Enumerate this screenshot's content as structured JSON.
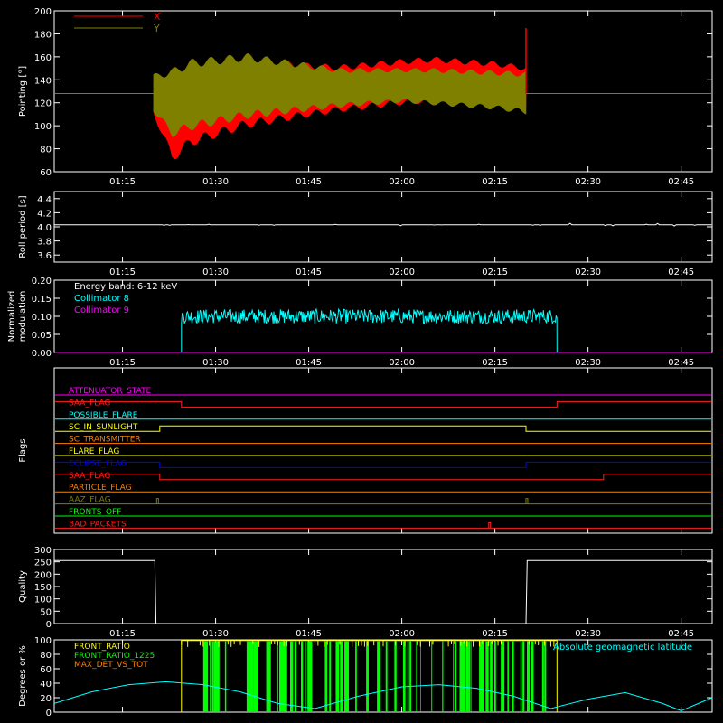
{
  "chart_data": [
    {
      "type": "line",
      "ylabel": "Pointing [°]",
      "ylim": [
        60,
        200
      ],
      "yticks": [
        "60",
        "80",
        "100",
        "120",
        "140",
        "160",
        "180",
        "200"
      ],
      "xticks": [
        "01:15",
        "01:30",
        "01:45",
        "02:00",
        "02:15",
        "02:30",
        "02:45"
      ],
      "xlim_minutes": [
        64,
        170
      ],
      "legend_placement": "top-left",
      "series": [
        {
          "name": "X",
          "color": "#ff0000",
          "baseline": 128,
          "active_start_min": 80,
          "active_end_min": 140,
          "envelope_start_min": [
            80,
            83,
            86,
            95,
            110,
            120,
            125,
            135,
            140
          ],
          "upper": [
            140,
            148,
            152,
            158,
            153,
            158,
            160,
            156,
            152
          ],
          "lower": [
            110,
            68,
            82,
            98,
            112,
            118,
            120,
            118,
            116
          ]
        },
        {
          "name": "Y",
          "color": "#808000",
          "baseline": 128,
          "active_start_min": 80,
          "active_end_min": 140,
          "envelope_start_min": [
            80,
            83,
            86,
            95,
            110,
            120,
            125,
            135,
            140
          ],
          "upper": [
            145,
            150,
            158,
            163,
            150,
            150,
            150,
            148,
            147
          ],
          "lower": [
            112,
            90,
            96,
            106,
            116,
            120,
            118,
            114,
            110
          ]
        }
      ]
    },
    {
      "type": "line",
      "ylabel": "Roll period [s]",
      "ylim": [
        3.5,
        4.5
      ],
      "yticks": [
        "3.6",
        "3.8",
        "4.0",
        "4.2",
        "4.4"
      ],
      "xticks": [
        "01:15",
        "01:30",
        "01:45",
        "02:00",
        "02:15",
        "02:30",
        "02:45"
      ],
      "series": [
        {
          "name": "",
          "color": "#ffffff",
          "value": 4.03
        }
      ]
    },
    {
      "type": "line",
      "ylabel": "Normalized modulation",
      "ylim": [
        0,
        0.2
      ],
      "yticks": [
        "0.00",
        "0.05",
        "0.10",
        "0.15",
        "0.20"
      ],
      "xticks": [
        "01:15",
        "01:30",
        "01:45",
        "02:00",
        "02:15",
        "02:30",
        "02:45"
      ],
      "annotation": "Energy band: 6-12 keV",
      "series": [
        {
          "name": "Collimator 8",
          "color": "#00ffff",
          "start_min": 84.5,
          "end_min": 145,
          "mean": 0.1,
          "spread": 0.02
        },
        {
          "name": "Collimator 9",
          "color": "#ff00ff",
          "value": 0.0
        }
      ]
    },
    {
      "type": "line",
      "ylabel": "Flags",
      "series": [
        {
          "name": "ATTENUATOR_STATE",
          "color": "#ff00ff",
          "changes": []
        },
        {
          "name": "SAA_FLAG",
          "color": "#ff2020",
          "changes": [
            [
              84.5,
              1,
              0
            ],
            [
              145,
              0,
              1
            ]
          ]
        },
        {
          "name": "POSSIBLE_FLARE",
          "color": "#00ffff",
          "changes": []
        },
        {
          "name": "SC_IN_SUNLIGHT",
          "color": "#ffff00",
          "changes": [
            [
              81,
              0,
              1
            ],
            [
              140,
              1,
              0
            ]
          ]
        },
        {
          "name": "SC_TRANSMITTER",
          "color": "#ff8000",
          "changes": []
        },
        {
          "name": "FLARE_FLAG",
          "color": "#ffff00",
          "changes": []
        },
        {
          "name": "ECLIPSE_FLAG",
          "color": "#0000ff",
          "changes": [
            [
              81,
              1,
              0
            ],
            [
              140,
              0,
              1
            ]
          ]
        },
        {
          "name": "SAA_FLAG",
          "color": "#ff2020",
          "changes": [
            [
              81,
              1,
              0
            ],
            [
              152.5,
              0,
              1
            ]
          ]
        },
        {
          "name": "PARTICLE_FLAG",
          "color": "#ff8000",
          "changes": []
        },
        {
          "name": "AAZ_FLAG",
          "color": "#808000",
          "spikes": [
            80.5,
            140
          ]
        },
        {
          "name": "FRONTS_OFF",
          "color": "#00ff00",
          "changes": []
        },
        {
          "name": "BAD_PACKETS",
          "color": "#ff2020",
          "spikes": [
            134
          ]
        }
      ]
    },
    {
      "type": "line",
      "ylabel": "Quality",
      "ylim": [
        0,
        300
      ],
      "yticks": [
        "0",
        "50",
        "100",
        "150",
        "200",
        "250",
        "300"
      ],
      "xticks": [
        "01:15",
        "01:30",
        "01:45",
        "02:00",
        "02:15",
        "02:30",
        "02:45"
      ],
      "series": [
        {
          "name": "",
          "color": "#ffffff",
          "points": [
            [
              64,
              255
            ],
            [
              80.2,
              255
            ],
            [
              80.4,
              0
            ],
            [
              140,
              0
            ],
            [
              140.2,
              255
            ],
            [
              170,
              255
            ]
          ]
        }
      ]
    },
    {
      "type": "line",
      "ylabel": "Degrees or %",
      "ylim": [
        0,
        100
      ],
      "yticks": [
        "0",
        "20",
        "40",
        "60",
        "80",
        "100"
      ],
      "annotation": "Absolute geomagnetic latitude",
      "series": [
        {
          "name": "FRONT_RATIO",
          "color": "#ffff00",
          "start_min": 84.5,
          "end_min": 145
        },
        {
          "name": "FRONT_RATIO_1225",
          "color": "#00ff00",
          "start_min": 88,
          "end_min": 144
        },
        {
          "name": "MAX_DET_VS_TOT",
          "color": "#ff8000"
        },
        {
          "name": "Absolute geomagnetic latitude",
          "color": "#00ffff",
          "points": [
            [
              64,
              12
            ],
            [
              70,
              28
            ],
            [
              76,
              38
            ],
            [
              82,
              42
            ],
            [
              88,
              38
            ],
            [
              94,
              28
            ],
            [
              100,
              12
            ],
            [
              106,
              5
            ],
            [
              113,
              22
            ],
            [
              120,
              35
            ],
            [
              126,
              38
            ],
            [
              132,
              33
            ],
            [
              138,
              22
            ],
            [
              144,
              5
            ],
            [
              150,
              18
            ],
            [
              156,
              27
            ],
            [
              162,
              12
            ],
            [
              165,
              2
            ],
            [
              170,
              20
            ]
          ]
        }
      ]
    }
  ],
  "colors": {
    "background": "#000000",
    "axes": "#ffffff"
  }
}
